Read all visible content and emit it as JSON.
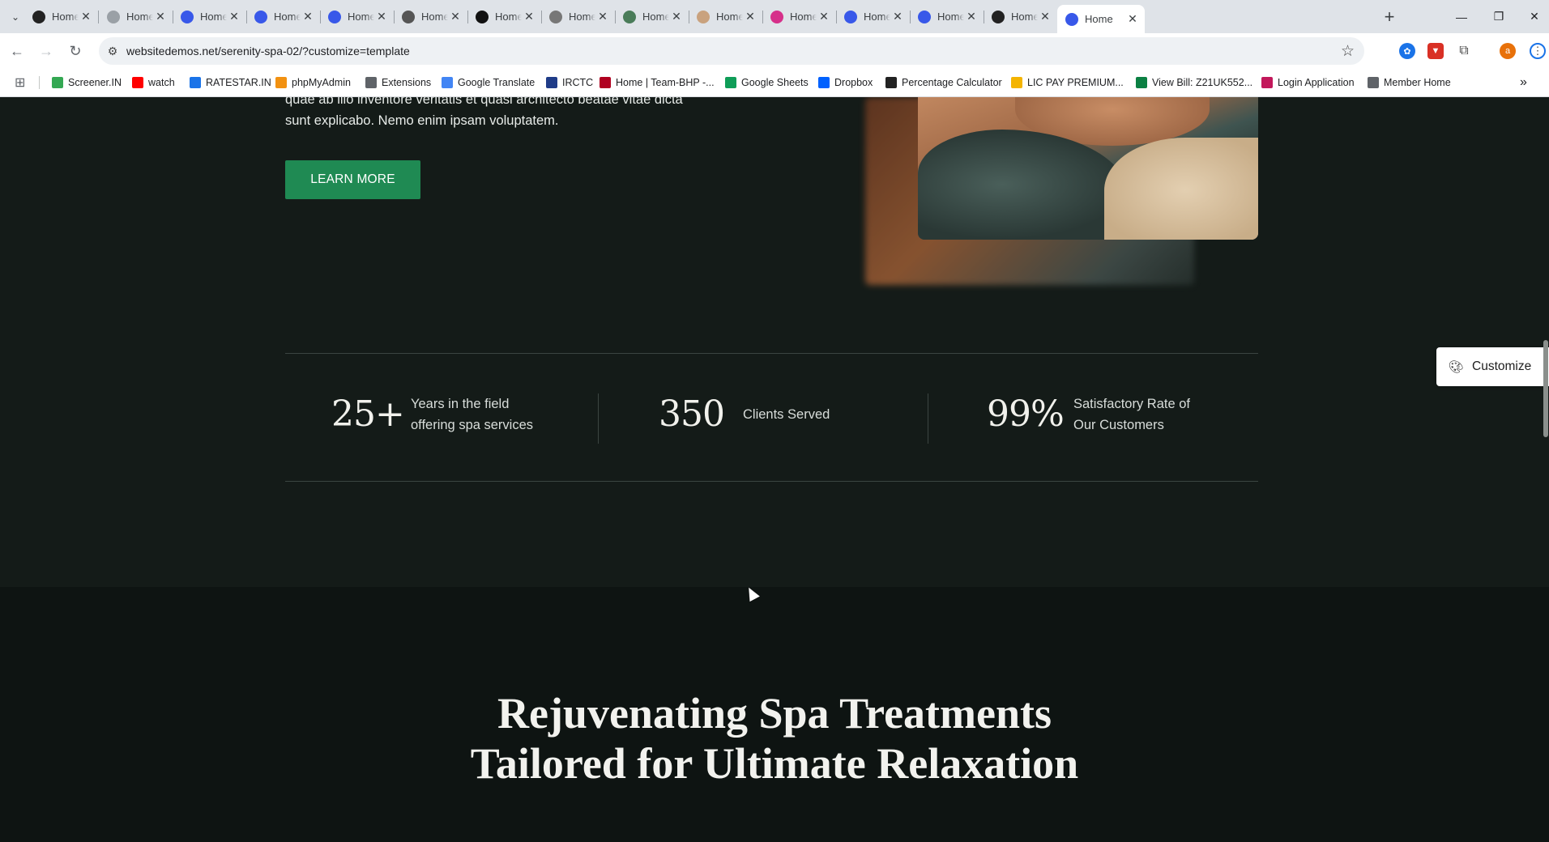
{
  "browser": {
    "tabs": [
      {
        "title": "Home",
        "favicon": "onk-icon",
        "color": "#222222"
      },
      {
        "title": "Home",
        "favicon": "swirl-icon",
        "color": "#9aa0a6"
      },
      {
        "title": "Home",
        "favicon": "wordpress-icon",
        "color": "#3858e9"
      },
      {
        "title": "Home",
        "favicon": "wordpress-icon",
        "color": "#3858e9"
      },
      {
        "title": "Home",
        "favicon": "wordpress-icon",
        "color": "#3858e9"
      },
      {
        "title": "Home",
        "favicon": "ring-icon",
        "color": "#555555"
      },
      {
        "title": "Home",
        "favicon": "kf-icon",
        "color": "#111111"
      },
      {
        "title": "Home",
        "favicon": "leaf-icon",
        "color": "#777777"
      },
      {
        "title": "Home",
        "favicon": "plant-icon",
        "color": "#4a7c59"
      },
      {
        "title": "Home",
        "favicon": "circle-icon",
        "color": "#c9a27e"
      },
      {
        "title": "Home",
        "favicon": "y-icon",
        "color": "#d6308a"
      },
      {
        "title": "Home",
        "favicon": "wordpress-icon",
        "color": "#3858e9"
      },
      {
        "title": "Home",
        "favicon": "wordpress-icon",
        "color": "#3858e9"
      },
      {
        "title": "Home",
        "favicon": "moon-icon",
        "color": "#222222"
      },
      {
        "title": "Home",
        "favicon": "wordpress-icon",
        "color": "#3858e9",
        "active": true
      }
    ],
    "new_tab": "+",
    "window_controls": {
      "minimize": "—",
      "restore": "❐",
      "close": "✕"
    },
    "nav": {
      "back": "←",
      "forward": "→",
      "reload": "↻"
    },
    "url": "websitedemos.net/serenity-spa-02/?customize=template",
    "bookmarks": [
      {
        "label": "Screener.IN",
        "color": "#34a853"
      },
      {
        "label": "watch",
        "color": "#ff0000"
      },
      {
        "label": "RATESTAR.IN",
        "color": "#1a73e8"
      },
      {
        "label": "phpMyAdmin",
        "color": "#f29111"
      },
      {
        "label": "Extensions",
        "color": "#5f6368"
      },
      {
        "label": "Google Translate",
        "color": "#4285f4"
      },
      {
        "label": "IRCTC",
        "color": "#1f3c88"
      },
      {
        "label": "Home | Team-BHP -...",
        "color": "#b00020"
      },
      {
        "label": "Google Sheets",
        "color": "#0f9d58"
      },
      {
        "label": "Dropbox",
        "color": "#0061fe"
      },
      {
        "label": "Percentage Calculator",
        "color": "#222222"
      },
      {
        "label": "LIC PAY PREMIUM...",
        "color": "#f4b400"
      },
      {
        "label": "View Bill: Z21UK552...",
        "color": "#0b8043"
      },
      {
        "label": "Login Application",
        "color": "#c2185b"
      },
      {
        "label": "Member Home",
        "color": "#5f6368"
      }
    ],
    "more_bookmarks": "»"
  },
  "page": {
    "hero_text_line1": "quae ab illo inventore veritatis et quasi architecto beatae vitae dicta",
    "hero_text_line2": "sunt explicabo. Nemo enim ipsam voluptatem.",
    "learn_more": "LEARN MORE",
    "stats": [
      {
        "number": "25+",
        "label_line1": "Years in the field",
        "label_line2": "offering spa services"
      },
      {
        "number": "350",
        "label_line1": "Clients Served",
        "label_line2": ""
      },
      {
        "number": "99%",
        "label_line1": "Satisfactory Rate of",
        "label_line2": "Our Customers"
      }
    ],
    "heading_line1": "Rejuvenating Spa Treatments",
    "heading_line2": "Tailored for Ultimate Relaxation",
    "customize": "Customize",
    "colors": {
      "accent": "#1f8a53",
      "background": "#141b18",
      "background_dark": "#0e1412"
    }
  }
}
